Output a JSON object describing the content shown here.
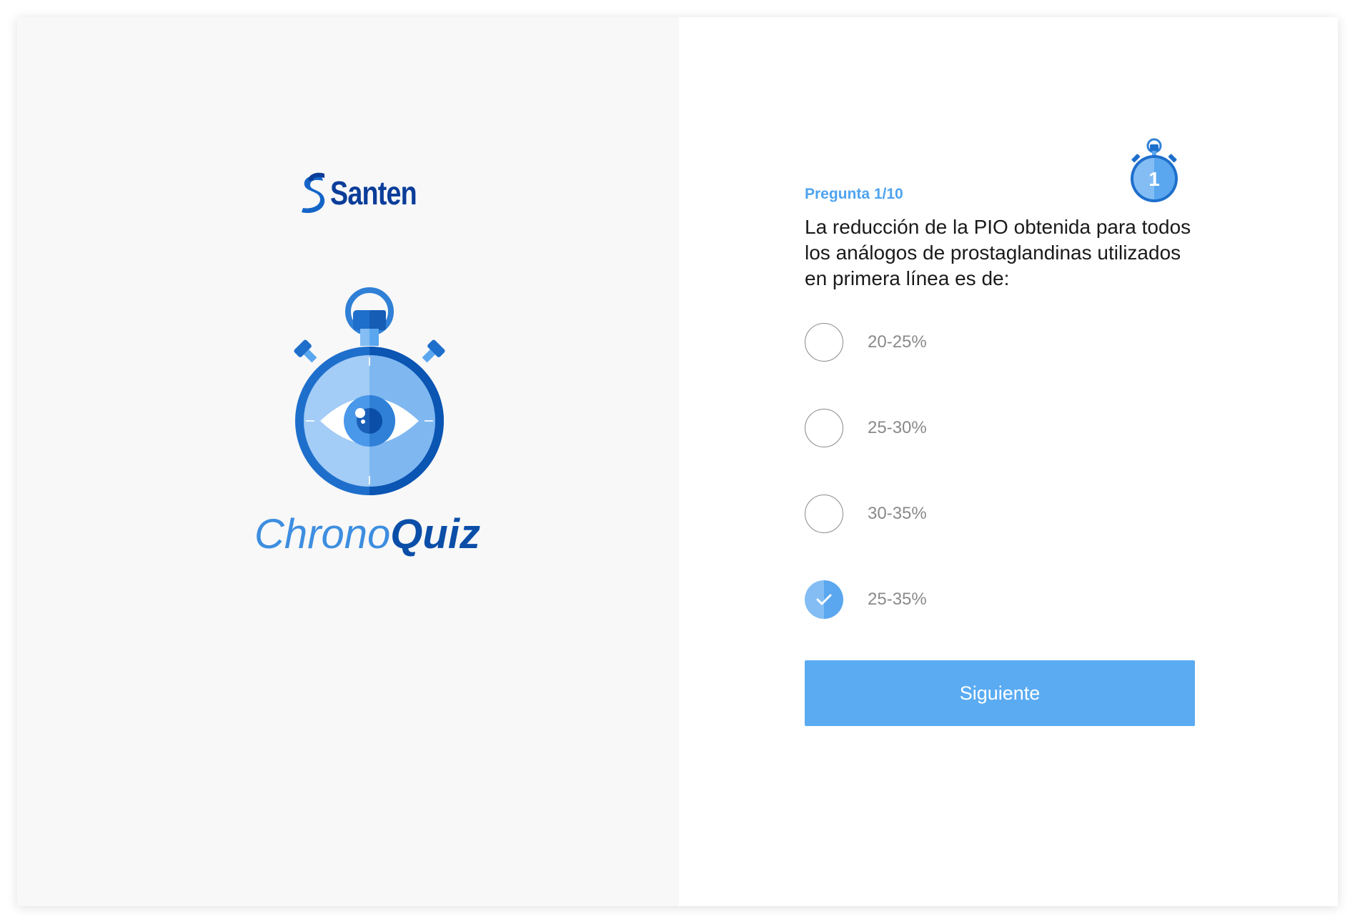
{
  "brand": {
    "logo_text": "Santen",
    "logo_icon": "santen-s-logo-icon"
  },
  "app": {
    "title_part1": "Chrono",
    "title_part2": "Quiz",
    "hero_icon": "stopwatch-eye-icon"
  },
  "quiz": {
    "counter": "Pregunta 1/10",
    "timer_value": "1",
    "timer_icon": "stopwatch-timer-icon",
    "question": "La reducción de la PIO obtenida para todos los análogos de prostaglandinas utilizados en primera línea es de:",
    "options": [
      {
        "label": "20-25%",
        "selected": false
      },
      {
        "label": "25-30%",
        "selected": false
      },
      {
        "label": "30-35%",
        "selected": false
      },
      {
        "label": "25-35%",
        "selected": true
      }
    ],
    "next_label": "Siguiente"
  },
  "colors": {
    "accent": "#5aabf2",
    "brand_dark": "#0b4ea8",
    "brand_mid": "#3d8ee0",
    "counter": "#4ea3ef",
    "left_panel_bg": "#f8f8f8"
  }
}
